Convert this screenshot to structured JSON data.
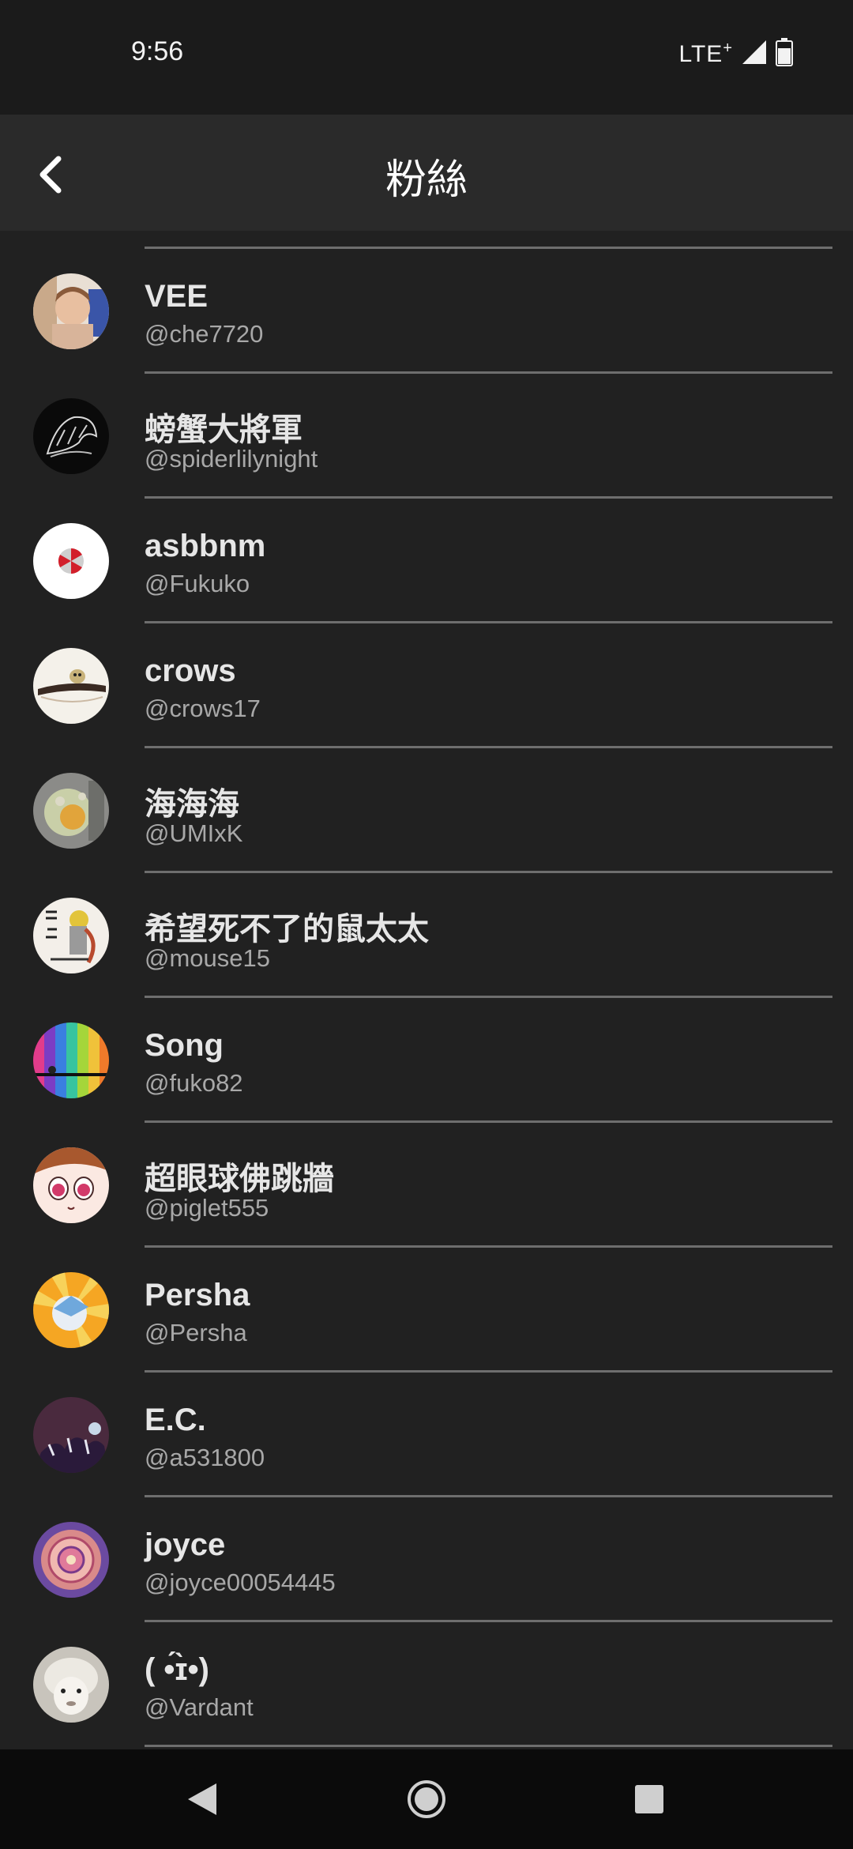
{
  "status_bar": {
    "time": "9:56",
    "network": "LTE",
    "network_suffix": "+"
  },
  "app_bar": {
    "title": "粉絲"
  },
  "followers": [
    {
      "name": "VEE",
      "handle": "@che7720"
    },
    {
      "name": "螃蟹大將軍",
      "handle": "@spiderlilynight"
    },
    {
      "name": "asbbnm",
      "handle": "@Fukuko"
    },
    {
      "name": "crows",
      "handle": "@crows17"
    },
    {
      "name": "海海海",
      "handle": "@UMIxK"
    },
    {
      "name": "希望死不了的鼠太太",
      "handle": "@mouse15"
    },
    {
      "name": "Song",
      "handle": "@fuko82"
    },
    {
      "name": "超眼球佛跳牆",
      "handle": "@piglet555"
    },
    {
      "name": "Persha",
      "handle": "@Persha"
    },
    {
      "name": "E.C.",
      "handle": "@a531800"
    },
    {
      "name": "joyce",
      "handle": "@joyce00054445"
    },
    {
      "name": "( •́ɪ̀•)",
      "handle": "@Vardant"
    }
  ],
  "icons": {
    "back": "chevron-left-icon",
    "signal": "signal-icon",
    "battery": "battery-icon",
    "nav_back": "triangle-back-icon",
    "nav_home": "circle-home-icon",
    "nav_recents": "square-recents-icon"
  },
  "colors": {
    "background": "#212121",
    "app_bar": "#2a2a2a",
    "status_bar": "#1b1b1b",
    "nav_bar": "#0b0b0b"
  }
}
